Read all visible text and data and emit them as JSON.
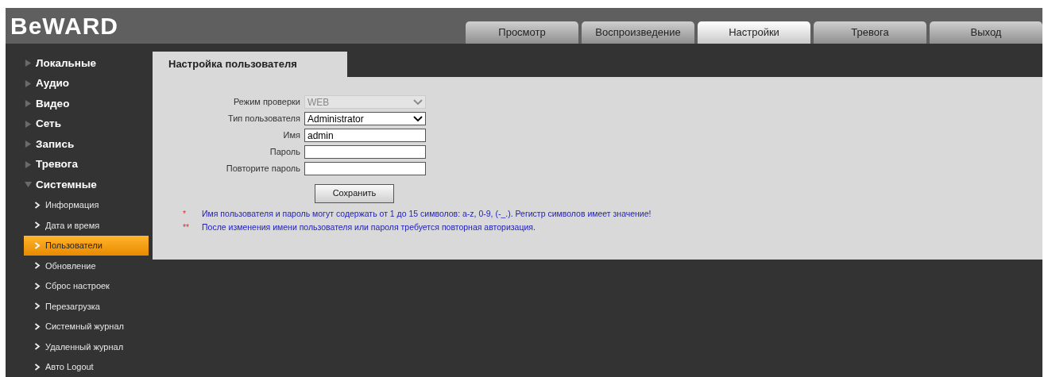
{
  "logo": "BeWARD",
  "tabs": [
    {
      "label": "Просмотр",
      "selected": false
    },
    {
      "label": "Воспроизведение",
      "selected": false
    },
    {
      "label": "Настройки",
      "selected": true
    },
    {
      "label": "Тревога",
      "selected": false
    },
    {
      "label": "Выход",
      "selected": false
    }
  ],
  "sidebar": {
    "items": [
      {
        "label": "Локальные",
        "expanded": false
      },
      {
        "label": "Аудио",
        "expanded": false
      },
      {
        "label": "Видео",
        "expanded": false
      },
      {
        "label": "Сеть",
        "expanded": false
      },
      {
        "label": "Запись",
        "expanded": false
      },
      {
        "label": "Тревога",
        "expanded": false
      },
      {
        "label": "Системные",
        "expanded": true,
        "children": [
          {
            "label": "Информация",
            "selected": false
          },
          {
            "label": "Дата и время",
            "selected": false
          },
          {
            "label": "Пользователи",
            "selected": true
          },
          {
            "label": "Обновление",
            "selected": false
          },
          {
            "label": "Сброс настроек",
            "selected": false
          },
          {
            "label": "Перезагрузка",
            "selected": false
          },
          {
            "label": "Системный журнал",
            "selected": false
          },
          {
            "label": "Удаленный журнал",
            "selected": false
          },
          {
            "label": "Авто Logout",
            "selected": false
          }
        ]
      }
    ]
  },
  "panel": {
    "title": "Настройка пользователя",
    "fields": [
      {
        "label": "Режим проверки",
        "kind": "select",
        "value": "WEB",
        "disabled": true
      },
      {
        "label": "Тип пользователя",
        "kind": "select",
        "value": "Administrator",
        "disabled": false
      },
      {
        "label": "Имя",
        "kind": "text",
        "value": "admin",
        "disabled": false
      },
      {
        "label": "Пароль",
        "kind": "text",
        "disabled": false
      },
      {
        "label": "Повторите пароль",
        "kind": "text",
        "disabled": false
      }
    ],
    "save_button": "Сохранить",
    "notes": [
      {
        "mark": "*",
        "text": "Имя пользователя и пароль могут содержать от 1 до 15 символов: a-z, 0-9, (-_.). Регистр символов имеет значение!"
      },
      {
        "mark": "**",
        "text": "После изменения имени пользователя или пароля требуется повторная авторизация."
      }
    ]
  }
}
